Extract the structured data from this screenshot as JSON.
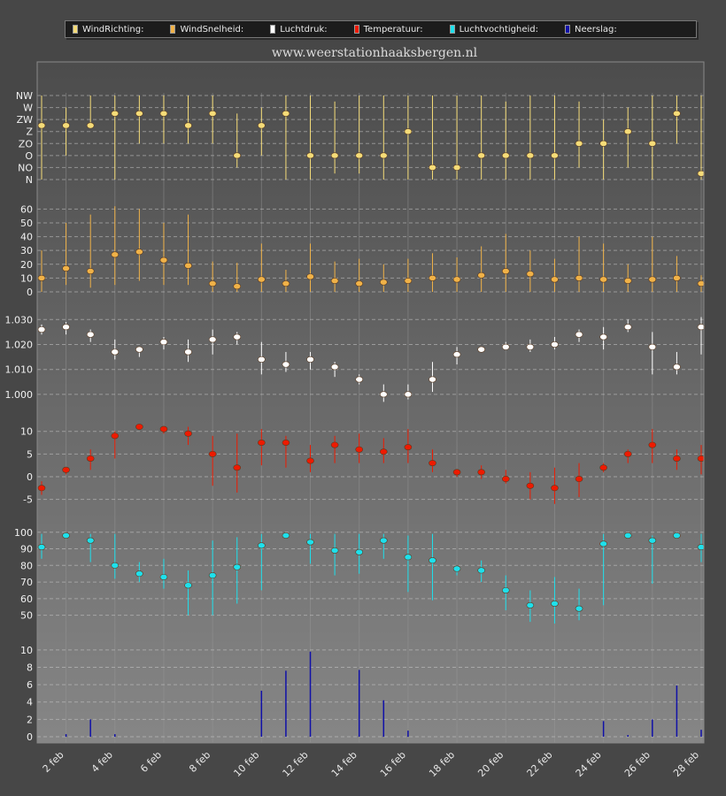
{
  "legend": [
    {
      "label": "WindRichting:",
      "color": "#f5dc78"
    },
    {
      "label": "WindSnelheid:",
      "color": "#f0b248"
    },
    {
      "label": "Luchtdruk:",
      "color": "#ffffff"
    },
    {
      "label": "Temperatuur:",
      "color": "#ee1a00"
    },
    {
      "label": "Luchtvochtigheid:",
      "color": "#1ee0ec"
    },
    {
      "label": "Neerslag:",
      "color": "#1010a8"
    }
  ],
  "site_title": "www.weerstationhaaksbergen.nl",
  "chart_data": {
    "type": "multi-panel",
    "x_labels": [
      "2 feb",
      "4 feb",
      "6 feb",
      "8 feb",
      "10 feb",
      "12 feb",
      "14 feb",
      "16 feb",
      "18 feb",
      "20 feb",
      "22 feb",
      "24 feb",
      "26 feb",
      "28 feb"
    ],
    "days": [
      1,
      2,
      3,
      4,
      5,
      6,
      7,
      8,
      9,
      10,
      11,
      12,
      13,
      14,
      15,
      16,
      17,
      18,
      19,
      20,
      21,
      22,
      23,
      24,
      25,
      26,
      27,
      28
    ],
    "panels": [
      {
        "name": "WindRichting",
        "color": "#f5dc78",
        "tick_labels": [
          "N",
          "NO",
          "O",
          "ZO",
          "Z",
          "ZW",
          "W",
          "NW"
        ],
        "ticks": [
          0,
          1,
          2,
          3,
          4,
          5,
          6,
          7
        ],
        "range": [
          0,
          7
        ],
        "values": [
          4.5,
          4.5,
          4.5,
          5.5,
          5.5,
          5.5,
          4.5,
          5.5,
          2,
          4.5,
          5.5,
          2,
          2,
          2,
          2,
          4,
          1,
          1,
          2,
          2,
          2,
          2,
          3,
          3,
          4,
          3,
          5.5,
          0.5
        ],
        "low": [
          0,
          2,
          4.5,
          0,
          3,
          3,
          3,
          3,
          1,
          2,
          0,
          0,
          0.5,
          0.5,
          0,
          0,
          0,
          0,
          0,
          0,
          0,
          0,
          1,
          0,
          1,
          0,
          3,
          0
        ],
        "high": [
          7,
          6,
          7,
          7,
          7,
          7,
          7,
          7,
          5.5,
          6,
          7,
          7,
          6.5,
          7,
          7,
          7,
          7,
          7,
          7,
          6.5,
          7,
          7,
          6.5,
          5,
          6,
          7,
          7,
          7
        ]
      },
      {
        "name": "WindSnelheid",
        "color": "#f0b248",
        "ticks": [
          0,
          10,
          20,
          30,
          40,
          50,
          60
        ],
        "tick_labels": [
          "0",
          "10",
          "20",
          "30",
          "40",
          "50",
          "60"
        ],
        "range": [
          0,
          66
        ],
        "values": [
          10,
          17,
          15,
          27,
          29,
          23,
          19,
          6,
          4,
          9,
          6,
          11,
          8,
          6,
          7,
          8,
          10,
          9,
          12,
          15,
          13,
          9,
          10,
          9,
          8,
          9,
          10,
          6
        ],
        "low": [
          0,
          5,
          3,
          5,
          8,
          5,
          5,
          0,
          0,
          0,
          0,
          0,
          0,
          0,
          0,
          0,
          0,
          0,
          0,
          0,
          0,
          0,
          0,
          0,
          0,
          0,
          0,
          0
        ],
        "high": [
          30,
          50,
          56,
          62,
          60,
          50,
          56,
          22,
          21,
          35,
          16,
          35,
          22,
          24,
          20,
          24,
          28,
          25,
          33,
          42,
          30,
          24,
          40,
          35,
          20,
          40,
          26,
          12
        ]
      },
      {
        "name": "Luchtdruk",
        "color": "#ffffff",
        "ticks": [
          1000,
          1010,
          1020,
          1030
        ],
        "tick_labels": [
          "1.000",
          "1.010",
          "1.020",
          "1.030"
        ],
        "range": [
          995,
          1034
        ],
        "values": [
          1026,
          1027,
          1024,
          1017,
          1018,
          1021,
          1017,
          1022,
          1023,
          1014,
          1012,
          1014,
          1011,
          1006,
          1000,
          1000,
          1006,
          1016,
          1018,
          1019,
          1019,
          1020,
          1024,
          1023,
          1027,
          1019,
          1011,
          1027
        ],
        "low": [
          1024,
          1024,
          1021,
          1014,
          1015,
          1018,
          1013,
          1016,
          1020,
          1008,
          1009,
          1010,
          1007,
          1004,
          997,
          998,
          1001,
          1012,
          1017,
          1018,
          1017,
          1018,
          1021,
          1018,
          1025,
          1008,
          1008,
          1016
        ],
        "high": [
          1028,
          1029,
          1026,
          1022,
          1019,
          1023,
          1022,
          1026,
          1025,
          1021,
          1017,
          1017,
          1013,
          1008,
          1004,
          1004,
          1013,
          1019,
          1019,
          1021,
          1022,
          1023,
          1026,
          1027,
          1030,
          1025,
          1017,
          1031
        ]
      },
      {
        "name": "Temperatuur",
        "color": "#ee1a00",
        "ticks": [
          -5,
          0,
          5,
          10
        ],
        "tick_labels": [
          "-5",
          "0",
          "5",
          "10"
        ],
        "range": [
          -8,
          11.5
        ],
        "values": [
          -2.5,
          1.5,
          4,
          9,
          11,
          10.5,
          9.5,
          5,
          2,
          7.5,
          7.5,
          3.5,
          7,
          6,
          5.5,
          6.5,
          3,
          1,
          1,
          -0.5,
          -2,
          -2.5,
          -0.5,
          2,
          5,
          7,
          4,
          4
        ],
        "low": [
          -4,
          0.5,
          1.5,
          4,
          10.5,
          9.5,
          7,
          -2,
          -3.5,
          2.5,
          2,
          1,
          3,
          3,
          3,
          3,
          1,
          0,
          -0.5,
          -1.5,
          -5,
          -6,
          -4.5,
          1,
          3,
          3,
          1.5,
          0.5
        ],
        "high": [
          -1,
          2,
          6,
          10,
          11.5,
          11,
          11,
          9,
          9.5,
          10.5,
          9,
          7,
          9,
          9.5,
          8.5,
          10.5,
          6,
          1.5,
          2.5,
          1.5,
          1,
          2,
          3,
          3,
          6,
          10.5,
          6,
          7
        ]
      },
      {
        "name": "Luchtvochtigheid",
        "color": "#1ee0ec",
        "ticks": [
          50,
          60,
          70,
          80,
          90,
          100
        ],
        "tick_labels": [
          "50",
          "60",
          "70",
          "80",
          "90",
          "100"
        ],
        "range": [
          45,
          102
        ],
        "values": [
          91,
          98,
          95,
          80,
          75,
          73,
          68,
          74,
          79,
          92,
          98,
          94,
          89,
          88,
          95,
          85,
          83,
          78,
          77,
          65,
          56,
          57,
          54,
          93,
          98,
          95,
          98,
          91
        ],
        "low": [
          84,
          97,
          82,
          72,
          70,
          66,
          50,
          50,
          57,
          65,
          97,
          81,
          74,
          75,
          84,
          64,
          59,
          74,
          70,
          53,
          46,
          45,
          47,
          56,
          97,
          69,
          97,
          82
        ],
        "high": [
          99,
          99,
          99,
          99,
          82,
          84,
          77,
          95,
          97,
          99,
          99,
          99,
          99,
          99,
          99,
          98,
          99,
          80,
          83,
          74,
          65,
          73,
          66,
          99,
          99,
          98,
          99,
          99
        ]
      },
      {
        "name": "Neerslag",
        "color": "#1010a8",
        "ticks": [
          0,
          2,
          4,
          6,
          8,
          10
        ],
        "tick_labels": [
          "0",
          "2",
          "4",
          "6",
          "8",
          "10"
        ],
        "range": [
          0,
          11
        ],
        "values": [
          0,
          0.3,
          2,
          0.3,
          0,
          0,
          0,
          0,
          0,
          5.3,
          7.6,
          9.8,
          0,
          7.7,
          4.2,
          0.7,
          0,
          0,
          0,
          0,
          0,
          0,
          0,
          1.8,
          0.2,
          2,
          5.9,
          0.8
        ]
      }
    ]
  }
}
